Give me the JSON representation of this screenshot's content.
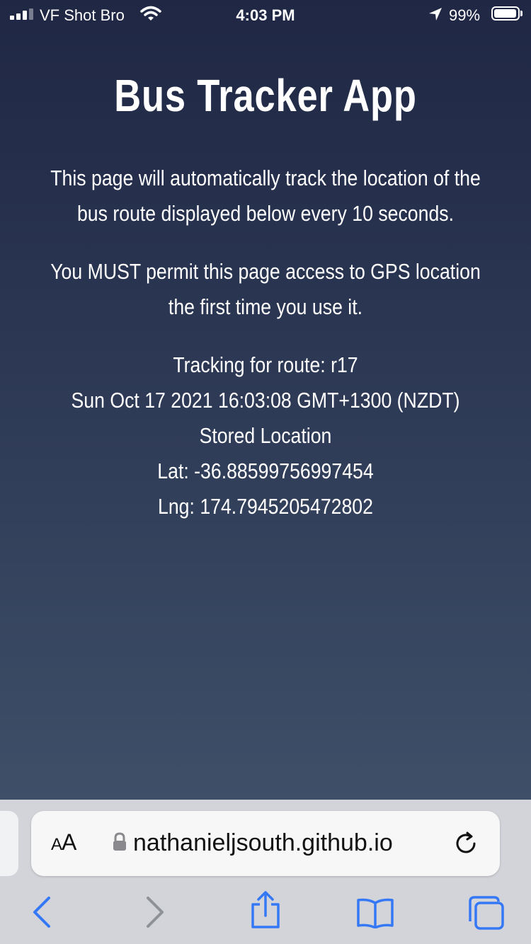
{
  "status_bar": {
    "carrier": "VF Shot Bro",
    "time": "4:03 PM",
    "battery": "99%"
  },
  "page": {
    "title": "Bus Tracker App",
    "paragraph1": "This page will automatically track the location of the bus route displayed below every 10 seconds.",
    "paragraph2": "You MUST permit this page access to GPS location the first time you use it.",
    "tracking": "Tracking for route: r17",
    "timestamp": "Sun Oct 17 2021 16:03:08 GMT+1300 (NZDT)",
    "stored_heading": "Stored Location",
    "lat": "Lat: -36.88599756997454",
    "lng": "Lng: 174.7945205472802"
  },
  "browser": {
    "aa_big": "A",
    "aa_small": "A",
    "url": "nathanieljsouth.github.io",
    "icons": [
      "lock-icon",
      "reload-icon",
      "back-icon",
      "forward-icon",
      "share-icon",
      "bookmarks-icon",
      "tabs-icon"
    ],
    "accent_color": "#3478f6"
  }
}
